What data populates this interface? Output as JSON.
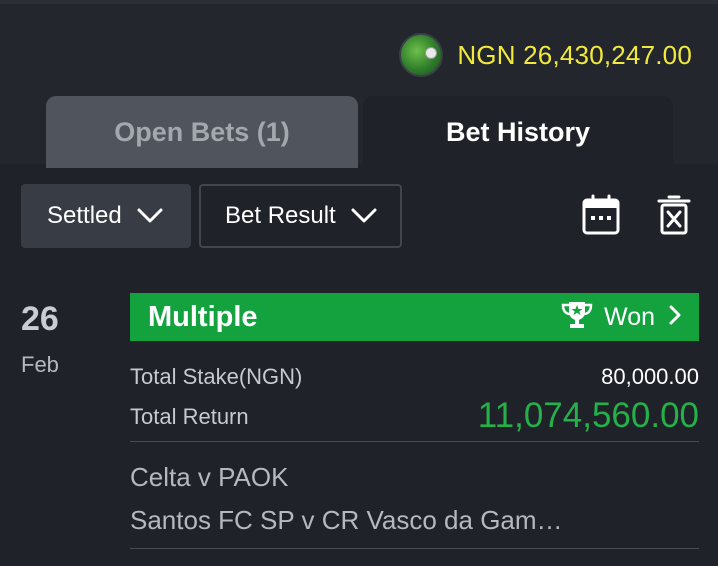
{
  "balance": {
    "text": "NGN 26,430,247.00",
    "color": "#f2ea3b"
  },
  "tabs": [
    {
      "label": "Open Bets (1)",
      "active": false
    },
    {
      "label": "Bet History",
      "active": true
    }
  ],
  "filters": {
    "status": "Settled",
    "result": "Bet Result"
  },
  "icons": [
    "calendar-icon",
    "trash-icon",
    "chevron-down-icon",
    "trophy-icon",
    "chevron-right-icon"
  ],
  "bet": {
    "day": "26",
    "month": "Feb",
    "type": "Multiple",
    "result": "Won",
    "stake_label": "Total Stake(NGN)",
    "stake_value": "80,000.00",
    "return_label": "Total Return",
    "return_value": "11,074,560.00",
    "events": [
      "Celta v PAOK",
      "Santos FC SP v CR Vasco da Gam…"
    ]
  },
  "colors": {
    "background": "#1f2228",
    "accent_green": "#14a23f",
    "return_green": "#25b14a",
    "balance_yellow": "#f2ea3b"
  }
}
